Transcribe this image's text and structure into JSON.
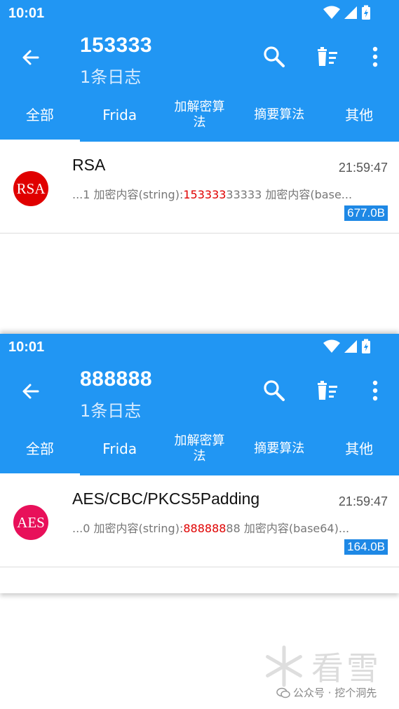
{
  "screens": [
    {
      "status": {
        "time": "10:01"
      },
      "toolbar": {
        "title": "153333",
        "subtitle": "1条日志"
      },
      "tabs": [
        "全部",
        "Frida",
        "加解密算法",
        "摘要算法",
        "其他"
      ],
      "item": {
        "avatar": "RSA",
        "avatar_color": "#e00000",
        "name": "RSA",
        "time": "21:59:47",
        "preview_prefix": "...1 加密内容(string):",
        "preview_highlight": "153333",
        "preview_suffix": "33333 加密内容(base...",
        "size": "677.0B"
      }
    },
    {
      "status": {
        "time": "10:01"
      },
      "toolbar": {
        "title": "888888",
        "subtitle": "1条日志"
      },
      "tabs": [
        "全部",
        "Frida",
        "加解密算法",
        "摘要算法",
        "其他"
      ],
      "item": {
        "avatar": "AES",
        "avatar_color": "#e8105a",
        "name": "AES/CBC/PKCS5Padding",
        "time": "21:59:47",
        "preview_prefix": "...0 加密内容(string):",
        "preview_highlight": "888888",
        "preview_suffix": "88 加密内容(base64)...",
        "size": "164.0B"
      }
    }
  ],
  "watermark": {
    "brand": "看雪",
    "credit": "公众号 · 挖个洞先"
  },
  "colors": {
    "primary": "#2196f3",
    "highlight": "#e00000",
    "badge": "#1e88e5"
  }
}
